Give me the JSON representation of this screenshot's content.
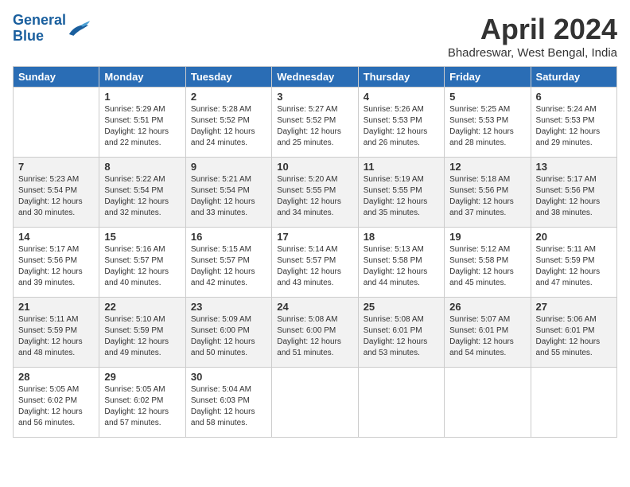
{
  "header": {
    "logo_line1": "General",
    "logo_line2": "Blue",
    "title": "April 2024",
    "subtitle": "Bhadreswar, West Bengal, India"
  },
  "weekdays": [
    "Sunday",
    "Monday",
    "Tuesday",
    "Wednesday",
    "Thursday",
    "Friday",
    "Saturday"
  ],
  "weeks": [
    [
      {
        "day": "",
        "info": ""
      },
      {
        "day": "1",
        "info": "Sunrise: 5:29 AM\nSunset: 5:51 PM\nDaylight: 12 hours\nand 22 minutes."
      },
      {
        "day": "2",
        "info": "Sunrise: 5:28 AM\nSunset: 5:52 PM\nDaylight: 12 hours\nand 24 minutes."
      },
      {
        "day": "3",
        "info": "Sunrise: 5:27 AM\nSunset: 5:52 PM\nDaylight: 12 hours\nand 25 minutes."
      },
      {
        "day": "4",
        "info": "Sunrise: 5:26 AM\nSunset: 5:53 PM\nDaylight: 12 hours\nand 26 minutes."
      },
      {
        "day": "5",
        "info": "Sunrise: 5:25 AM\nSunset: 5:53 PM\nDaylight: 12 hours\nand 28 minutes."
      },
      {
        "day": "6",
        "info": "Sunrise: 5:24 AM\nSunset: 5:53 PM\nDaylight: 12 hours\nand 29 minutes."
      }
    ],
    [
      {
        "day": "7",
        "info": "Sunrise: 5:23 AM\nSunset: 5:54 PM\nDaylight: 12 hours\nand 30 minutes."
      },
      {
        "day": "8",
        "info": "Sunrise: 5:22 AM\nSunset: 5:54 PM\nDaylight: 12 hours\nand 32 minutes."
      },
      {
        "day": "9",
        "info": "Sunrise: 5:21 AM\nSunset: 5:54 PM\nDaylight: 12 hours\nand 33 minutes."
      },
      {
        "day": "10",
        "info": "Sunrise: 5:20 AM\nSunset: 5:55 PM\nDaylight: 12 hours\nand 34 minutes."
      },
      {
        "day": "11",
        "info": "Sunrise: 5:19 AM\nSunset: 5:55 PM\nDaylight: 12 hours\nand 35 minutes."
      },
      {
        "day": "12",
        "info": "Sunrise: 5:18 AM\nSunset: 5:56 PM\nDaylight: 12 hours\nand 37 minutes."
      },
      {
        "day": "13",
        "info": "Sunrise: 5:17 AM\nSunset: 5:56 PM\nDaylight: 12 hours\nand 38 minutes."
      }
    ],
    [
      {
        "day": "14",
        "info": "Sunrise: 5:17 AM\nSunset: 5:56 PM\nDaylight: 12 hours\nand 39 minutes."
      },
      {
        "day": "15",
        "info": "Sunrise: 5:16 AM\nSunset: 5:57 PM\nDaylight: 12 hours\nand 40 minutes."
      },
      {
        "day": "16",
        "info": "Sunrise: 5:15 AM\nSunset: 5:57 PM\nDaylight: 12 hours\nand 42 minutes."
      },
      {
        "day": "17",
        "info": "Sunrise: 5:14 AM\nSunset: 5:57 PM\nDaylight: 12 hours\nand 43 minutes."
      },
      {
        "day": "18",
        "info": "Sunrise: 5:13 AM\nSunset: 5:58 PM\nDaylight: 12 hours\nand 44 minutes."
      },
      {
        "day": "19",
        "info": "Sunrise: 5:12 AM\nSunset: 5:58 PM\nDaylight: 12 hours\nand 45 minutes."
      },
      {
        "day": "20",
        "info": "Sunrise: 5:11 AM\nSunset: 5:59 PM\nDaylight: 12 hours\nand 47 minutes."
      }
    ],
    [
      {
        "day": "21",
        "info": "Sunrise: 5:11 AM\nSunset: 5:59 PM\nDaylight: 12 hours\nand 48 minutes."
      },
      {
        "day": "22",
        "info": "Sunrise: 5:10 AM\nSunset: 5:59 PM\nDaylight: 12 hours\nand 49 minutes."
      },
      {
        "day": "23",
        "info": "Sunrise: 5:09 AM\nSunset: 6:00 PM\nDaylight: 12 hours\nand 50 minutes."
      },
      {
        "day": "24",
        "info": "Sunrise: 5:08 AM\nSunset: 6:00 PM\nDaylight: 12 hours\nand 51 minutes."
      },
      {
        "day": "25",
        "info": "Sunrise: 5:08 AM\nSunset: 6:01 PM\nDaylight: 12 hours\nand 53 minutes."
      },
      {
        "day": "26",
        "info": "Sunrise: 5:07 AM\nSunset: 6:01 PM\nDaylight: 12 hours\nand 54 minutes."
      },
      {
        "day": "27",
        "info": "Sunrise: 5:06 AM\nSunset: 6:01 PM\nDaylight: 12 hours\nand 55 minutes."
      }
    ],
    [
      {
        "day": "28",
        "info": "Sunrise: 5:05 AM\nSunset: 6:02 PM\nDaylight: 12 hours\nand 56 minutes."
      },
      {
        "day": "29",
        "info": "Sunrise: 5:05 AM\nSunset: 6:02 PM\nDaylight: 12 hours\nand 57 minutes."
      },
      {
        "day": "30",
        "info": "Sunrise: 5:04 AM\nSunset: 6:03 PM\nDaylight: 12 hours\nand 58 minutes."
      },
      {
        "day": "",
        "info": ""
      },
      {
        "day": "",
        "info": ""
      },
      {
        "day": "",
        "info": ""
      },
      {
        "day": "",
        "info": ""
      }
    ]
  ]
}
